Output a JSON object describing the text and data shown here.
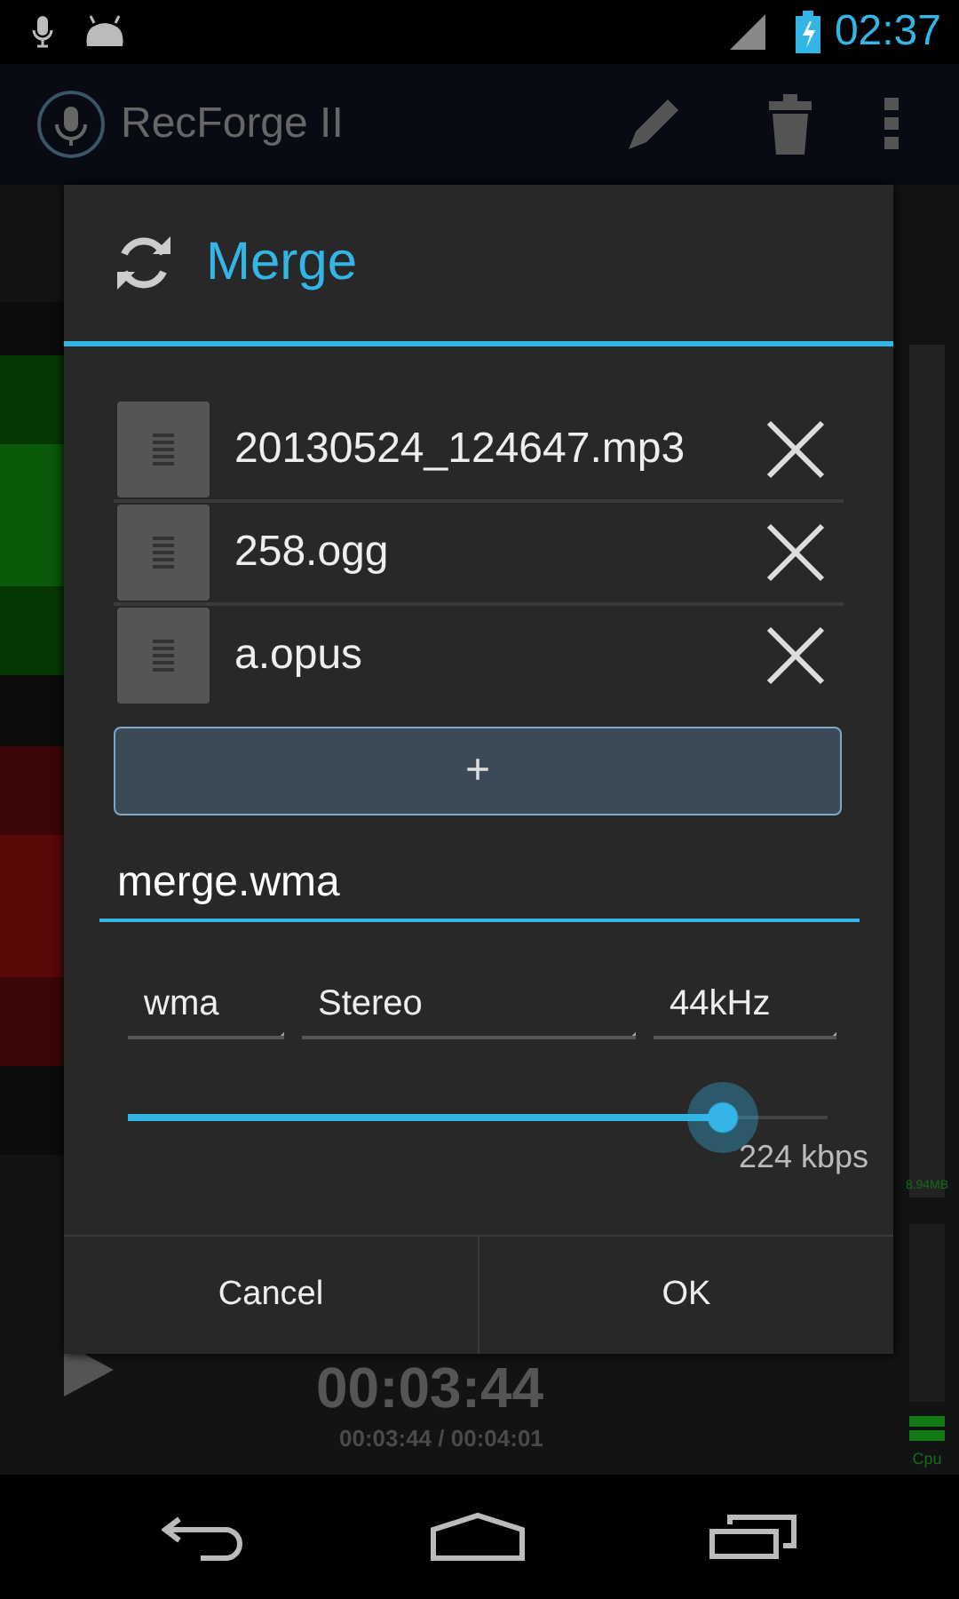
{
  "status_bar": {
    "time": "02:37"
  },
  "app_bar": {
    "title": "RecForge II"
  },
  "player": {
    "elapsed": "00:03:44",
    "position": "00:03:44 / 00:04:01"
  },
  "meter": {
    "memory": "8.94MB",
    "cpu": "Cpu"
  },
  "dialog": {
    "title": "Merge",
    "files": [
      {
        "name": "20130524_124647.mp3"
      },
      {
        "name": "258.ogg"
      },
      {
        "name": "a.opus"
      }
    ],
    "add_button": "+",
    "filename": {
      "value": "merge.wma"
    },
    "dropdowns": [
      {
        "value": "wma"
      },
      {
        "value": "Stereo"
      },
      {
        "value": "44kHz"
      }
    ],
    "bitrate": {
      "level": 0.85,
      "reading": "224 kbps"
    },
    "buttons": [
      "Cancel",
      "OK"
    ]
  }
}
